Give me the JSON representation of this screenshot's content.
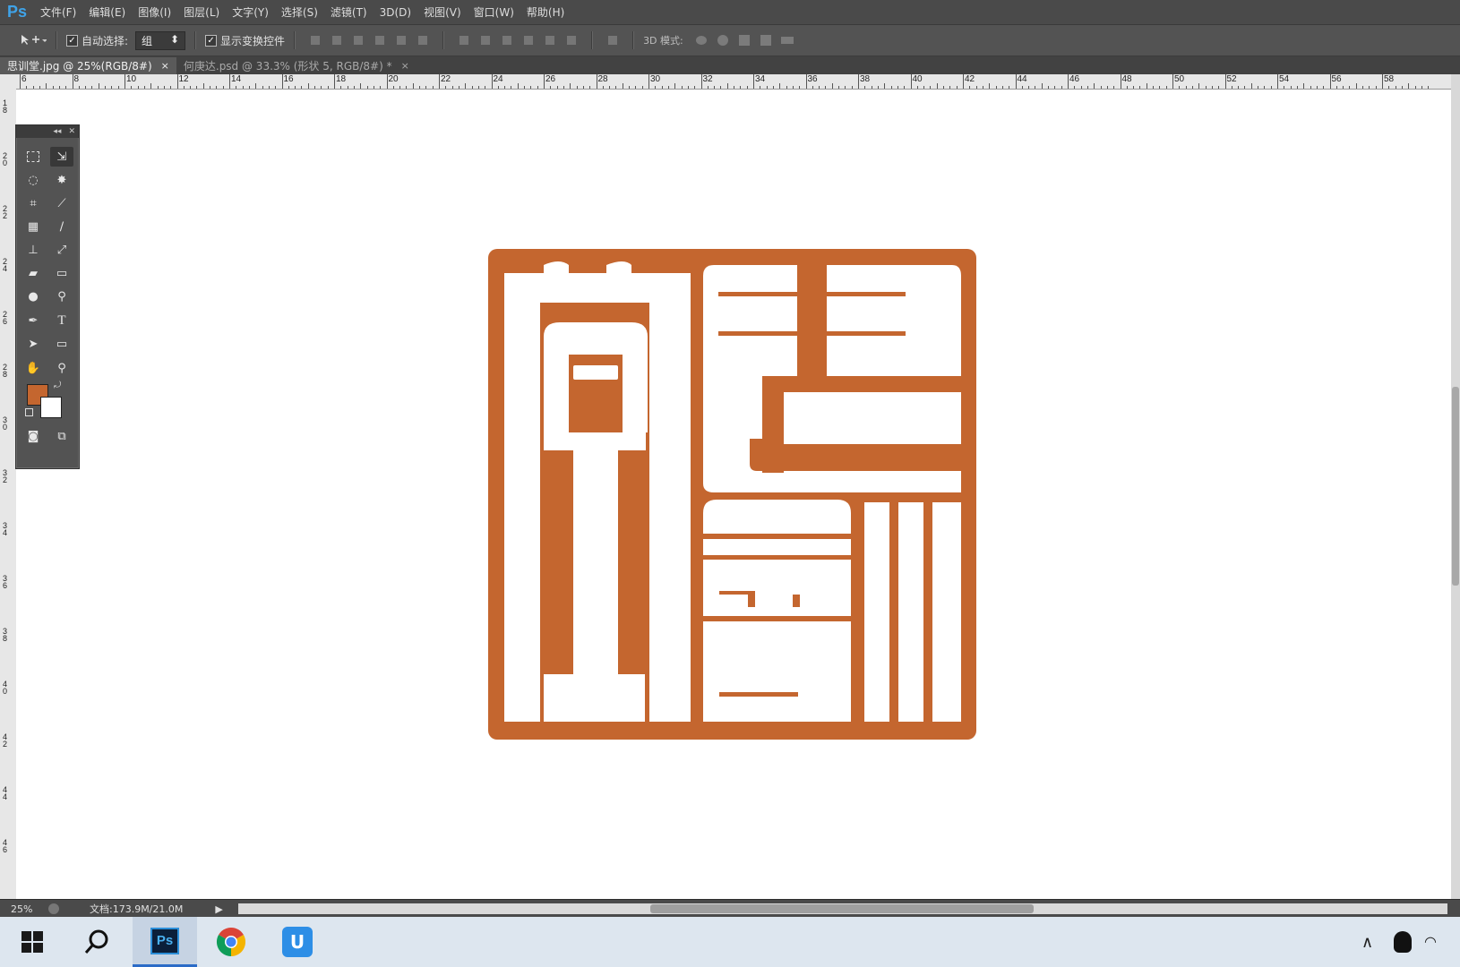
{
  "app": {
    "logo": "Ps"
  },
  "menu": [
    "文件(F)",
    "编辑(E)",
    "图像(I)",
    "图层(L)",
    "文字(Y)",
    "选择(S)",
    "滤镜(T)",
    "3D(D)",
    "视图(V)",
    "窗口(W)",
    "帮助(H)"
  ],
  "options": {
    "auto_select_label": "自动选择:",
    "auto_select_value": "组",
    "show_transform_label": "显示变换控件",
    "mode3d_label": "3D 模式:"
  },
  "tabs": [
    {
      "label": "思训堂.jpg @ 25%(RGB/8#)",
      "close": "×"
    },
    {
      "label": "何庚达.psd @ 33.3% (形状 5, RGB/8#) *",
      "close": "×"
    }
  ],
  "ruler_top": [
    "6",
    "8",
    "10",
    "12",
    "14",
    "16",
    "18",
    "20",
    "22",
    "24",
    "26",
    "28",
    "30",
    "32",
    "34",
    "36",
    "38",
    "40",
    "42",
    "44",
    "46",
    "48",
    "50",
    "52",
    "54",
    "56",
    "58"
  ],
  "ruler_left": [
    "18",
    "20",
    "22",
    "24",
    "26",
    "28",
    "30",
    "32",
    "34",
    "36",
    "38",
    "40",
    "42",
    "44",
    "46"
  ],
  "colors": {
    "foreground": "#c4662f",
    "background": "#ffffff",
    "seal": "#c4662f"
  },
  "status": {
    "zoom": "25%",
    "doc": "文档:173.9M/21.0M"
  },
  "taskbar": {
    "apps": [
      "start-icon",
      "search-icon",
      "photoshop-icon",
      "chrome-icon",
      "app-u-icon"
    ],
    "photoshop_label": "Ps",
    "u_label": "U"
  }
}
